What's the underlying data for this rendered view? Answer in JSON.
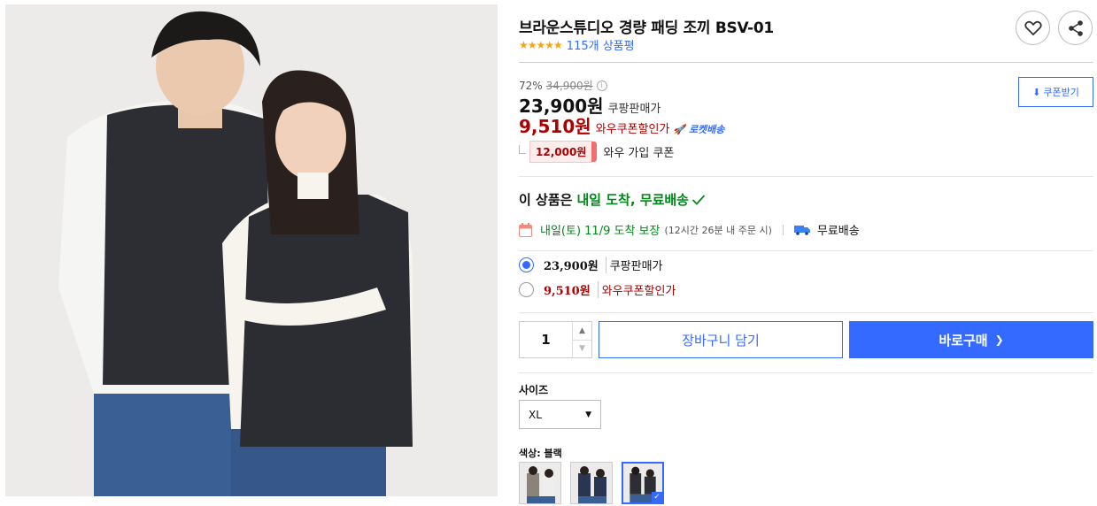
{
  "product": {
    "title": "브라운스튜디오 경량 패딩 조끼 BSV-01",
    "stars": "★★★★★",
    "review_count": "115개 상품평"
  },
  "actions": {
    "wishlist_icon": "heart-icon",
    "share_icon": "share-icon",
    "coupon_download": "쿠폰받기"
  },
  "pricing": {
    "discount_rate": "72%",
    "original_price": "34,900원",
    "info_icon": "i",
    "sale_price": "23,900원",
    "sale_label": "쿠팡판매가",
    "wow_price": "9,510원",
    "wow_label": "와우쿠폰할인가",
    "rocket_label": "로켓배송",
    "coupon_amount": "12,000원",
    "coupon_label": "와우 가입 쿠폰"
  },
  "delivery": {
    "headline_prefix": "이 상품은",
    "headline_highlight": "내일 도착, 무료배송",
    "arrival": "내일(토) 11/9 도착 보장",
    "arrival_sub": "(12시간 26분 내 주문 시)",
    "shipping": "무료배송"
  },
  "options": [
    {
      "price": "23,900원",
      "label": "쿠팡판매가",
      "selected": true
    },
    {
      "price": "9,510원",
      "label": "와우쿠폰할인가",
      "selected": false
    }
  ],
  "purchase": {
    "quantity": "1",
    "add_to_cart": "장바구니 담기",
    "buy_now": "바로구매",
    "buy_now_arrow": "❯"
  },
  "size": {
    "label": "사이즈",
    "selected": "XL"
  },
  "color": {
    "label": "색상: 블랙",
    "swatch_count": 3,
    "selected_index": 2
  },
  "colors": {
    "accent": "#346aff",
    "wow_red": "#ae0000",
    "delivery_green": "#00891a",
    "star": "#f7a21b"
  }
}
